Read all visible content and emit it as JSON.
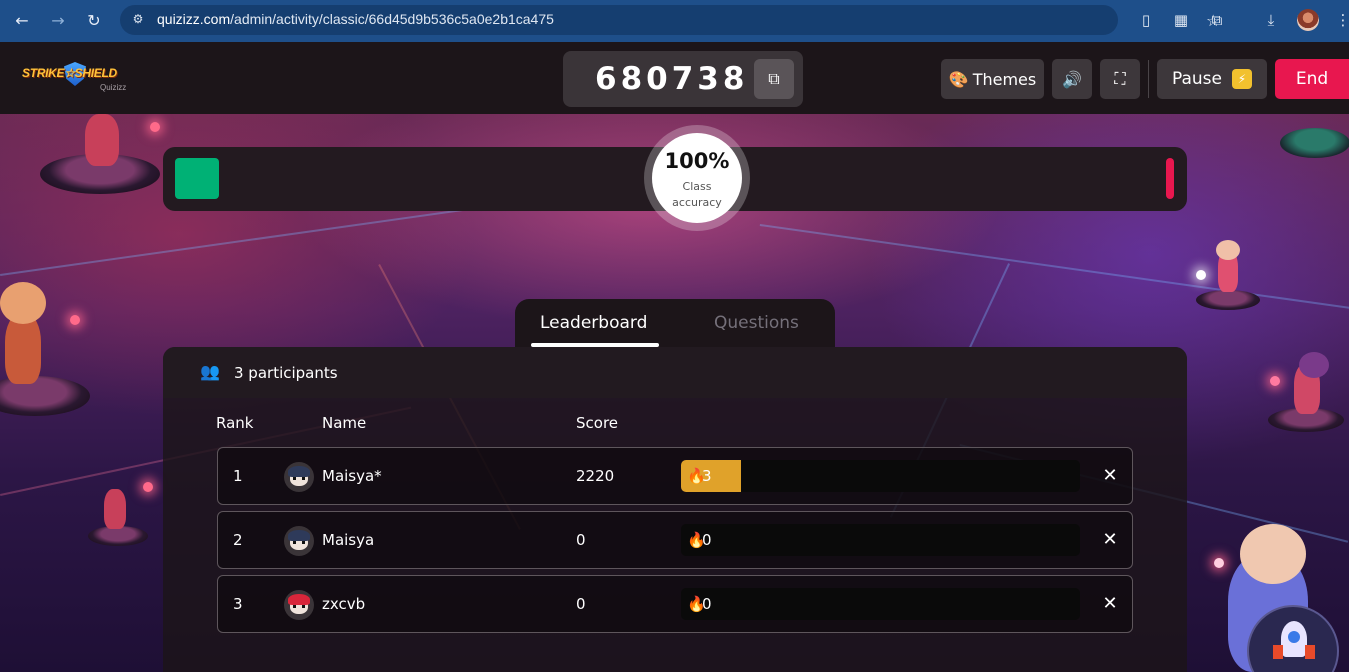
{
  "browser": {
    "url_host": "quizizz.com",
    "url_path": "/admin/activity/classic/66d45d9b536c5a0e2b1ca475",
    "icons": [
      "back-arrow-icon",
      "forward-arrow-icon",
      "reload-icon",
      "site-settings-icon",
      "bookmark-star-icon",
      "reading-list-icon",
      "extension-thumbnail-icon",
      "extensions-puzzle-icon",
      "download-icon",
      "profile-avatar",
      "kebab-menu-icon"
    ]
  },
  "header": {
    "logo_text": "STRIKE☆SHIELD",
    "logo_sub": "Quizizz",
    "game_code": "680738",
    "themes_label": "Themes",
    "pause_label": "Pause",
    "pause_badge": "⚡",
    "end_label": "End",
    "colors": {
      "end": "#e8174f",
      "pause_badge": "#f2c12e"
    }
  },
  "accuracy": {
    "value": "100%",
    "label": "Class accuracy",
    "correct_color": "#00b175",
    "incorrect_color": "#e8174f"
  },
  "tabs": [
    {
      "label": "Leaderboard",
      "active": true
    },
    {
      "label": "Questions",
      "active": false
    }
  ],
  "leaderboard": {
    "participants_label": "3 participants",
    "columns": {
      "rank": "Rank",
      "name": "Name",
      "score": "Score"
    },
    "rows": [
      {
        "rank": "1",
        "name": "Maisya*",
        "score": "2220",
        "streak": "3",
        "streak_fraction": 0.15,
        "avatar": "ninja-avatar"
      },
      {
        "rank": "2",
        "name": "Maisya",
        "score": "0",
        "streak": "0",
        "streak_fraction": 0,
        "avatar": "ninja-avatar"
      },
      {
        "rank": "3",
        "name": "zxcvb",
        "score": "0",
        "streak": "0",
        "streak_fraction": 0,
        "avatar": "red-cap-avatar"
      }
    ],
    "streak_color": "#e0a22a"
  }
}
